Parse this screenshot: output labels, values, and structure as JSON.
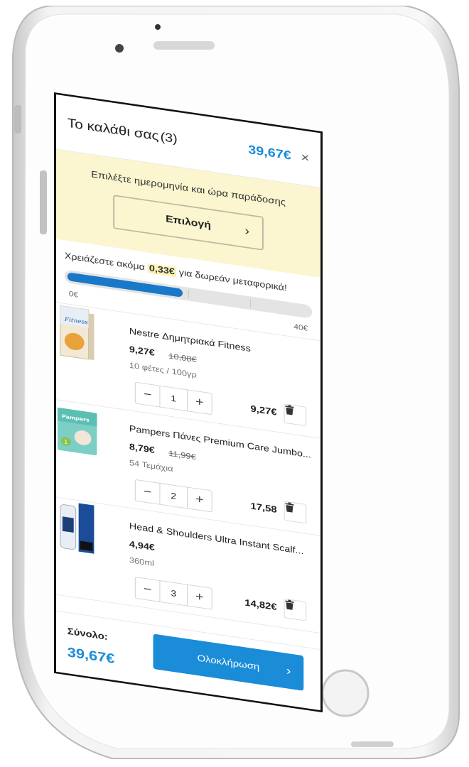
{
  "cart": {
    "title": "Το καλάθι σας",
    "count": "(3)",
    "total": "39,67€",
    "close_glyph": "×"
  },
  "delivery": {
    "message": "Επιλέξτε ημερομηνία και ώρα παράδοσης",
    "button_label": "Επιλογή",
    "button_chevron": "›"
  },
  "shipping": {
    "msg_before": "Χρειάζεστε ακόμα ",
    "amount": "0,33€",
    "msg_after": " για δωρεάν μεταφορικά!",
    "progress": 0.49,
    "min_label": "0€",
    "max_label": "40€"
  },
  "items": [
    {
      "name": "Nestre Δημητριακά Fitness",
      "price": "9,27€",
      "old_price": "10,08€",
      "unit": "10 φέτες / 100γρ",
      "qty": "1",
      "line_total": "9,27€"
    },
    {
      "name": "Pampers Πάνες Premium Care Jumbo...",
      "price": "8,79€",
      "old_price": "11,99€",
      "unit": "54 Τεμάχια",
      "qty": "2",
      "line_total": "17,58"
    },
    {
      "name": "Head & Shoulders Ultra Instant Scalf...",
      "price": "4,94€",
      "old_price": "",
      "unit": "360ml",
      "qty": "3",
      "line_total": "14,82€"
    }
  ],
  "stepper": {
    "minus": "−",
    "plus": "+"
  },
  "footer": {
    "label": "Σύνολο:",
    "total": "39,67€",
    "checkout_label": "Ολοκλήρωση",
    "checkout_chevron": "›"
  },
  "colors": {
    "accent": "#1a8cd8",
    "banner": "#fbf6cf",
    "progress": "#1a78c8"
  }
}
